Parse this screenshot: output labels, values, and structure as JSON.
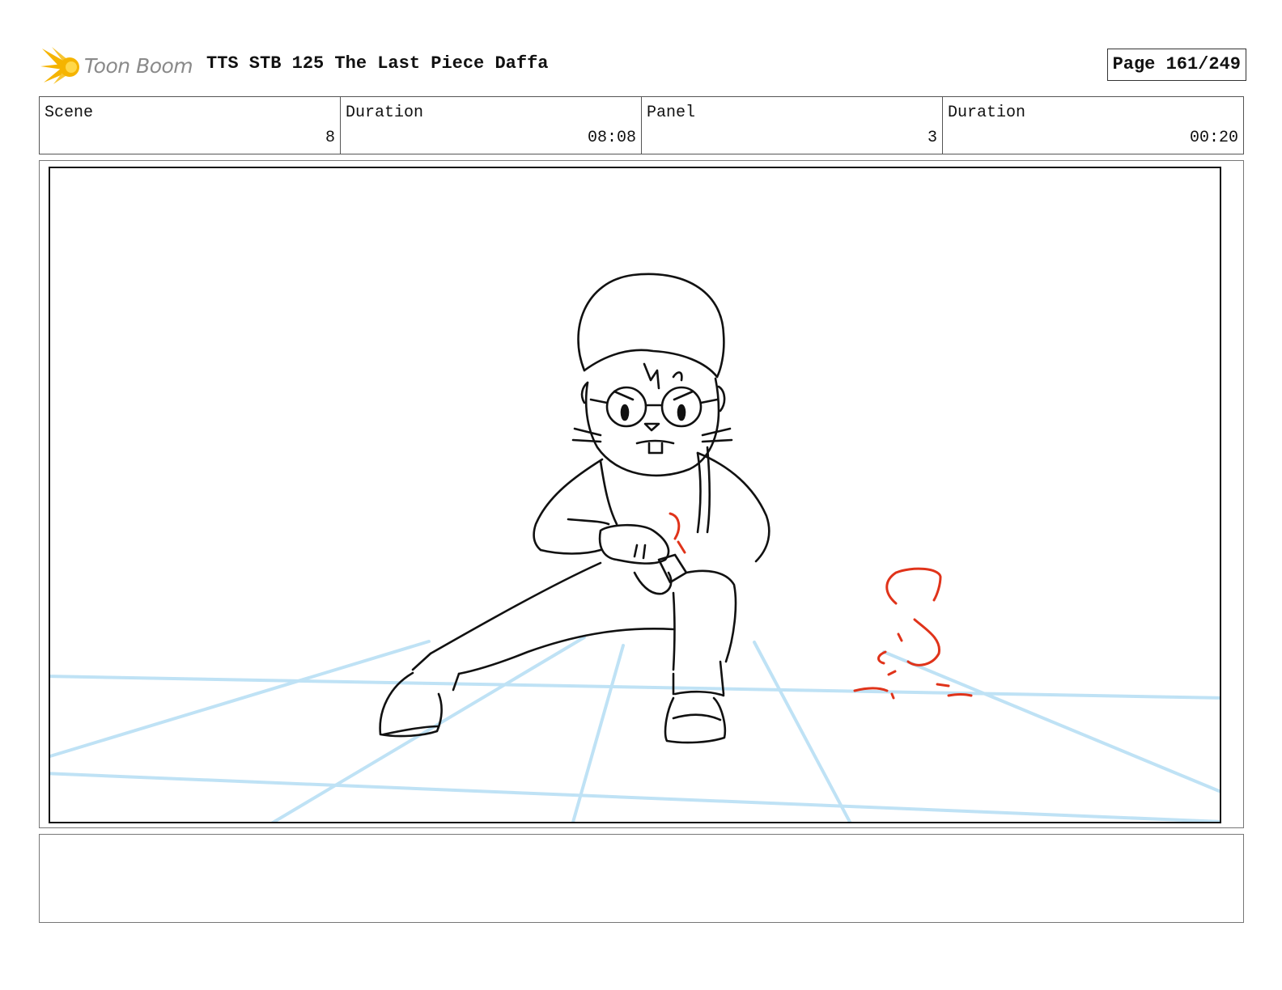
{
  "header": {
    "logo_text": "Toon Boom",
    "title": "TTS STB 125 The Last Piece Daffa",
    "page": "Page 161/249"
  },
  "info": [
    {
      "label": "Scene",
      "value": "8"
    },
    {
      "label": "Duration",
      "value": "08:08"
    },
    {
      "label": "Panel",
      "value": "3"
    },
    {
      "label": "Duration",
      "value": "00:20"
    }
  ],
  "colors": {
    "sketch_line": "#111111",
    "perspective_grid": "#bfe2f5",
    "effect_marks": "#e0331a",
    "logo_flare": "#f5b400"
  },
  "icons": {
    "logo": "toon-boom-flare-icon"
  },
  "notes": ""
}
